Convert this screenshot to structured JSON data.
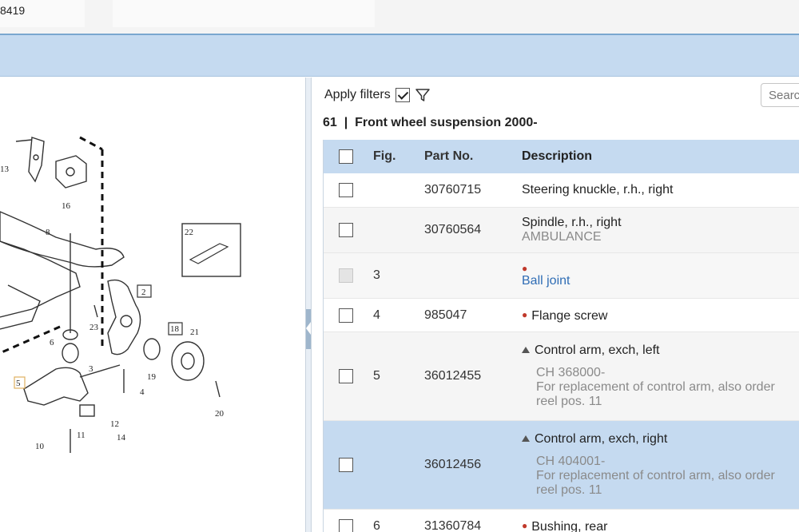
{
  "header": {
    "vin_fragment": "8419"
  },
  "filters": {
    "label": "Apply filters",
    "checked": true
  },
  "search": {
    "placeholder": "Search"
  },
  "group": {
    "number": "61",
    "separator": "|",
    "title": "Front wheel suspension 2000-"
  },
  "table": {
    "columns": {
      "fig": "Fig.",
      "part": "Part No.",
      "desc": "Description"
    },
    "rows": [
      {
        "fig": "",
        "part": "30760715",
        "desc": "Steering knuckle, r.h., right"
      },
      {
        "fig": "",
        "part": "30760564",
        "desc": "Spindle, r.h., right",
        "note": "AMBULANCE"
      },
      {
        "fig": "3",
        "part": "",
        "desc": "Ball joint"
      },
      {
        "fig": "4",
        "part": "985047",
        "desc": "Flange screw"
      },
      {
        "fig": "5",
        "part": "36012455",
        "desc": "Control arm, exch, left",
        "note1": "CH 368000-",
        "note2": "For replacement of control arm, also order",
        "note3": "reel pos. 11"
      },
      {
        "fig": "",
        "part": "36012456",
        "desc": "Control arm, exch, right",
        "note1": "CH 404001-",
        "note2": "For replacement of control arm, also order",
        "note3": "reel pos. 11"
      },
      {
        "fig": "6",
        "part": "31360784",
        "desc": "Bushing, rear"
      }
    ]
  },
  "diagram": {
    "callouts": [
      "13",
      "16",
      "8",
      "22",
      "2",
      "23",
      "18",
      "21",
      "6",
      "3",
      "19",
      "5",
      "4",
      "20",
      "11",
      "12",
      "14",
      "10"
    ]
  },
  "colors": {
    "accent": "#c5daf0",
    "link": "#2f6db5",
    "bullet": "#c0392b"
  }
}
